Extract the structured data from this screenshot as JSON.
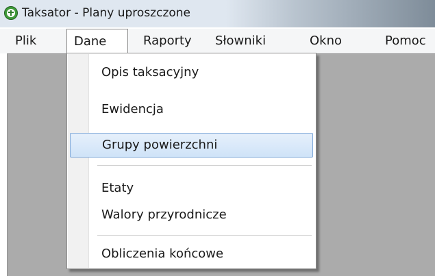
{
  "window": {
    "title": "Taksator - Plany uproszczone",
    "icon": "app-leaf-icon"
  },
  "menubar": {
    "items": [
      {
        "label": "Plik"
      },
      {
        "label": "Dane",
        "active": true
      },
      {
        "label": "Raporty"
      },
      {
        "label": "Słowniki"
      },
      {
        "label": "Okno"
      },
      {
        "label": "Pomoc"
      }
    ]
  },
  "dropdown": {
    "items": [
      {
        "label": "Opis taksacyjny"
      },
      {
        "label": "Ewidencja"
      },
      {
        "label": "Grupy powierzchni",
        "highlighted": true
      },
      {
        "label": "Etaty"
      },
      {
        "label": "Walory przyrodnicze"
      },
      {
        "label": "Obliczenia końcowe"
      }
    ]
  },
  "colors": {
    "highlight_border": "#7fa8d8",
    "highlight_fill": "#cfe3f8",
    "workspace": "#ababab"
  }
}
